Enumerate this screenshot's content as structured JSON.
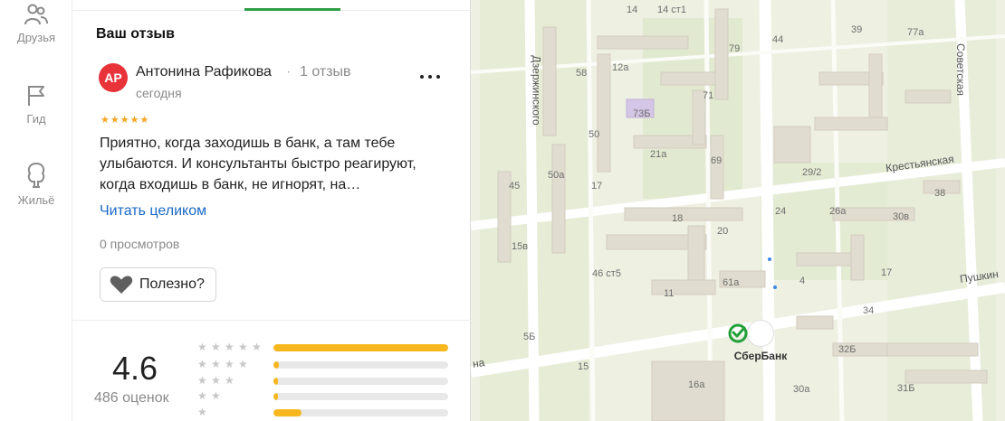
{
  "nav": {
    "friends": "Друзья",
    "guide": "Гид",
    "housing": "Жильё"
  },
  "review": {
    "section_title": "Ваш отзыв",
    "avatar_initials": "АР",
    "author": "Антонина Рафикова",
    "separator": "·",
    "author_reviews": "1 отзыв",
    "date": "сегодня",
    "stars": 5,
    "text": "Приятно, когда заходишь в банк, а там тебе улыбаются. И консультанты быстро реагируют, когда входишь в банк, не игнорят, на…",
    "read_more": "Читать целиком",
    "views": "0 просмотров",
    "useful_label": "Полезно?"
  },
  "summary": {
    "rating": "4.6",
    "count": "486 оценок",
    "distribution": [
      {
        "stars": 5,
        "fraction": 1.0
      },
      {
        "stars": 4,
        "fraction": 0.03
      },
      {
        "stars": 3,
        "fraction": 0.02
      },
      {
        "stars": 2,
        "fraction": 0.02
      },
      {
        "stars": 1,
        "fraction": 0.16
      }
    ]
  },
  "map": {
    "streets": {
      "dzerzhinsky": "Дзержинского",
      "sovetskaya": "Советская",
      "krestyanskaya": "Крестьянская",
      "pushkin": "Пушкин",
      "bottom_left": "на"
    },
    "houses": [
      "14",
      "14 ст1",
      "79",
      "44",
      "39",
      "77а",
      "58",
      "12а",
      "73Б",
      "71",
      "50",
      "21а",
      "69",
      "29/2",
      "50а",
      "45",
      "17",
      "18",
      "20",
      "24",
      "26а",
      "30в",
      "38",
      "15в",
      "46 ст5",
      "11",
      "61а",
      "17",
      "4",
      "34",
      "5Б",
      "32Б",
      "16а",
      "30а",
      "31Б",
      "15"
    ],
    "poi_name": "СберБанк"
  },
  "colors": {
    "accent_green": "#2f9e44",
    "avatar_red": "#e8333a",
    "star_gold": "#f5a623",
    "bar_fill": "#f7b71e",
    "link_blue": "#1a6ac8"
  }
}
